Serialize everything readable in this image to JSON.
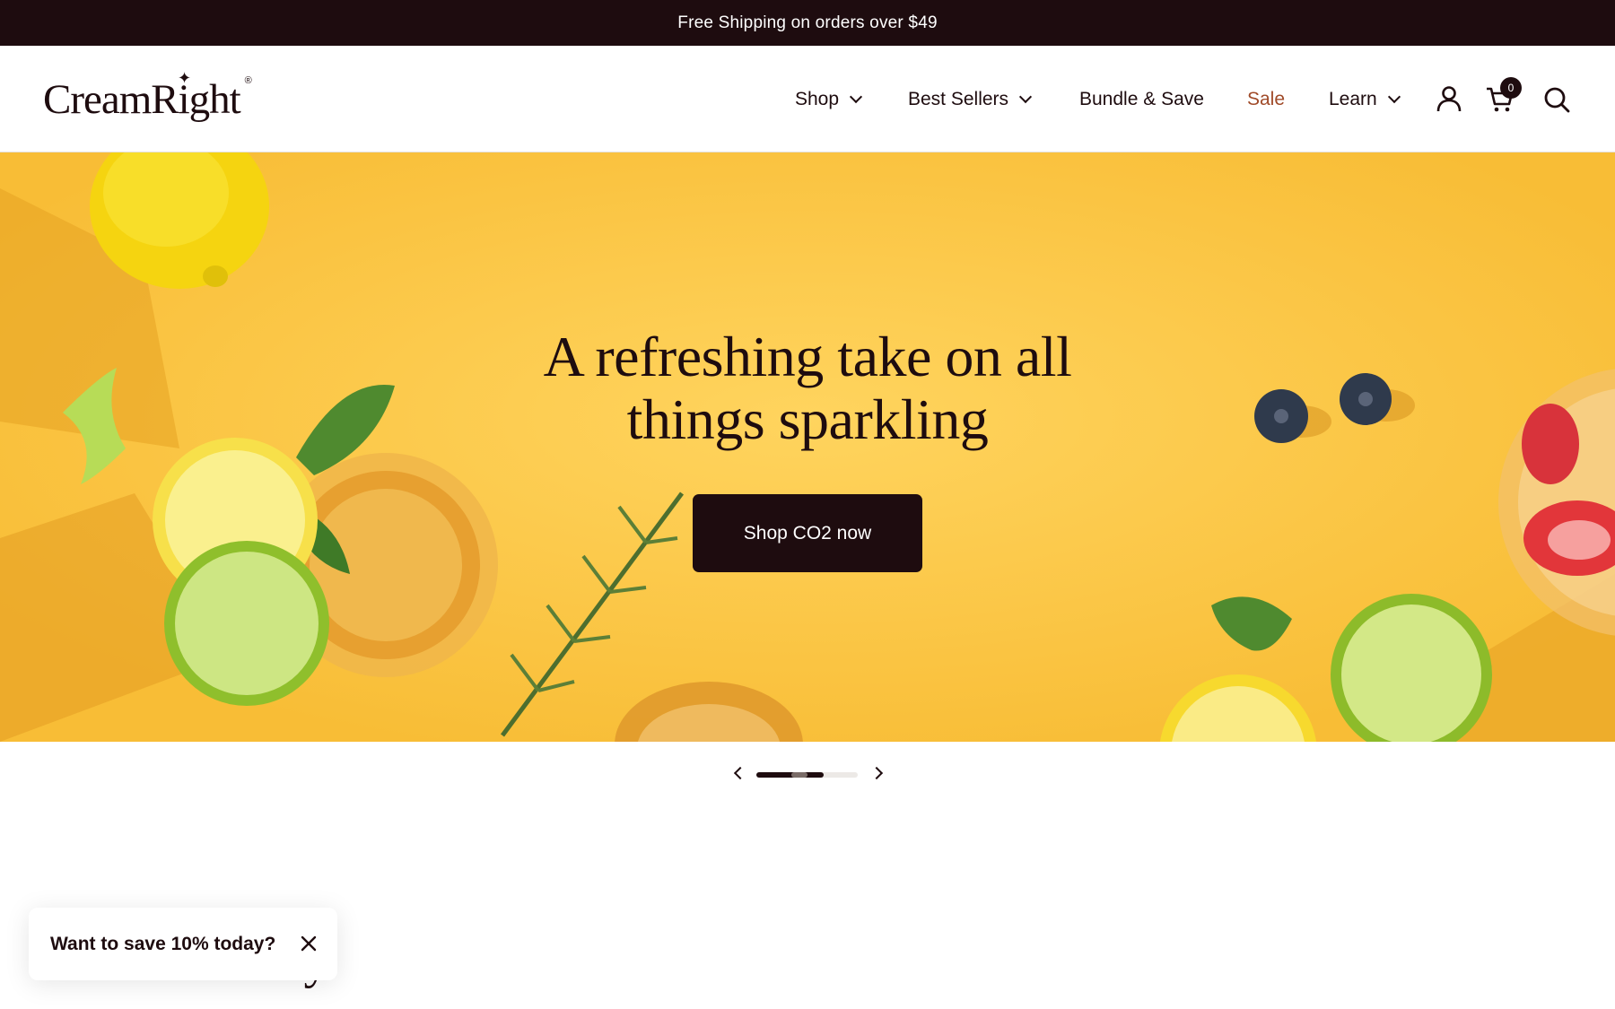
{
  "announcement": {
    "text": "Free Shipping on orders over $49"
  },
  "brand": {
    "name": "CreamRight",
    "registered": "®"
  },
  "nav": {
    "items": [
      {
        "label": "Shop"
      },
      {
        "label": "Best Sellers"
      },
      {
        "label": "Bundle & Save"
      },
      {
        "label": "Sale"
      },
      {
        "label": "Learn"
      }
    ],
    "cart_count": "0",
    "icons": [
      "account-icon",
      "cart-icon",
      "search-icon"
    ]
  },
  "hero": {
    "title_line1": "A refreshing take on all",
    "title_line2": "things sparkling",
    "cta_label": "Shop CO2 now",
    "background_color": "#fcc845"
  },
  "slider": {
    "current_fraction": 0.66
  },
  "section": {
    "title": "ry"
  },
  "popup": {
    "text": "Want to save 10% today?"
  },
  "colors": {
    "dark": "#1e0c0f",
    "sale": "#a04a28",
    "hero_yellow": "#fcc845"
  }
}
